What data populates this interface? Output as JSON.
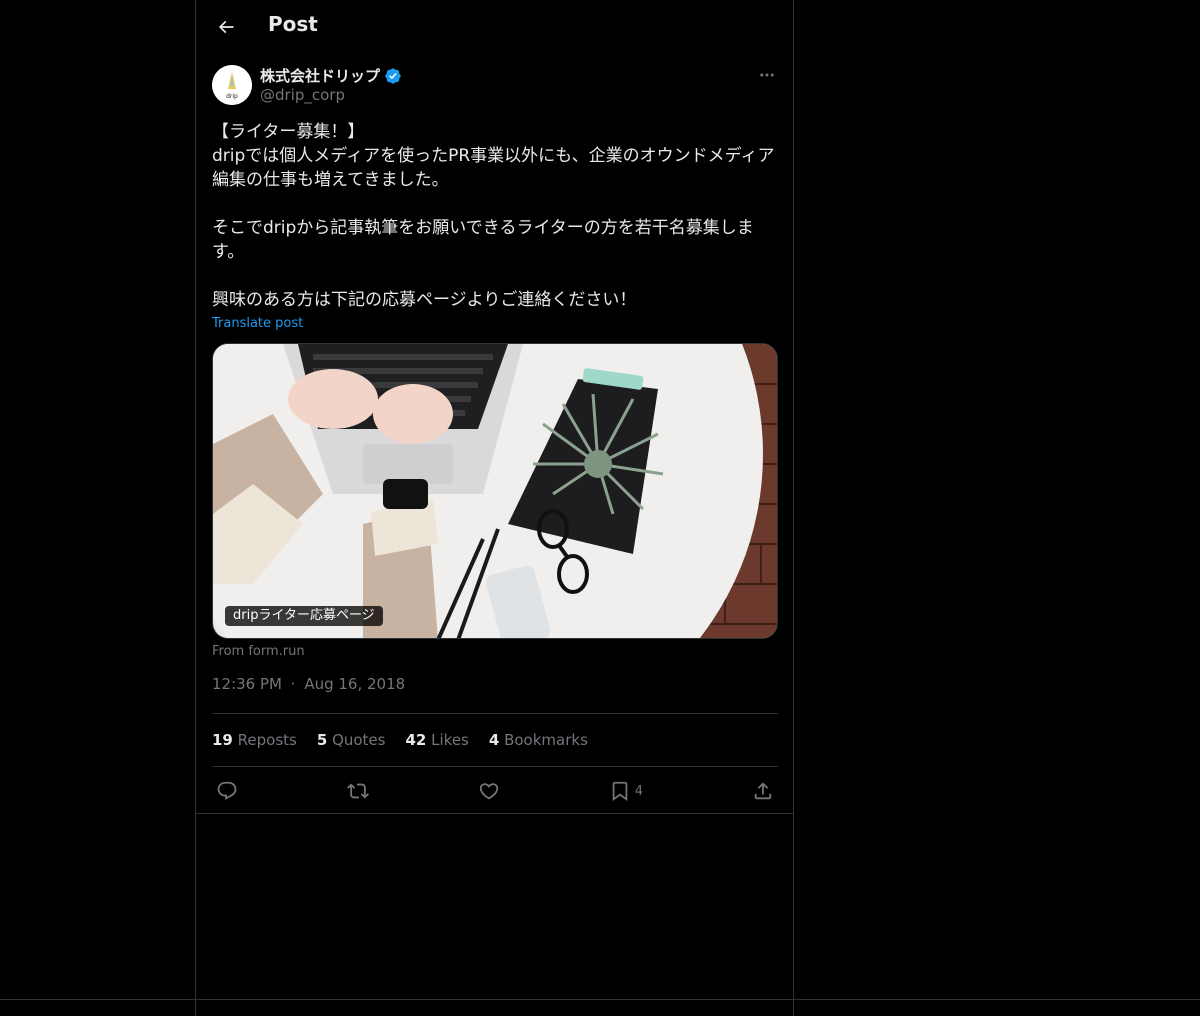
{
  "header": {
    "title": "Post"
  },
  "author": {
    "name": "株式会社ドリップ",
    "handle": "@drip_corp",
    "avatar_text": "drip"
  },
  "post": {
    "text": "【ライター募集！】\ndripでは個人メディアを使ったPR事業以外にも、企業のオウンドメディア編集の仕事も増えてきました。\n\nそこでdripから記事執筆をお願いできるライターの方を若干名募集します。\n\n興味のある方は下記の応募ページよりご連絡ください！",
    "translate_label": "Translate post",
    "card_label": "dripライター応募ページ",
    "card_from": "From form.run",
    "time": "12:36 PM",
    "date": "Aug 16, 2018",
    "separator": "·"
  },
  "stats": {
    "reposts_count": "19",
    "reposts_label": "Reposts",
    "quotes_count": "5",
    "quotes_label": "Quotes",
    "likes_count": "42",
    "likes_label": "Likes",
    "bookmarks_count": "4",
    "bookmarks_label": "Bookmarks"
  },
  "actions": {
    "bookmark_count": "4"
  },
  "colors": {
    "background": "#000000",
    "accent": "#1d9bf0",
    "border": "#2f3336",
    "muted": "#71767b",
    "text": "#e7e9ea"
  },
  "icons": [
    "back-arrow-icon",
    "verified-badge-icon",
    "more-icon",
    "reply-icon",
    "repost-icon",
    "like-icon",
    "bookmark-icon",
    "share-icon"
  ]
}
